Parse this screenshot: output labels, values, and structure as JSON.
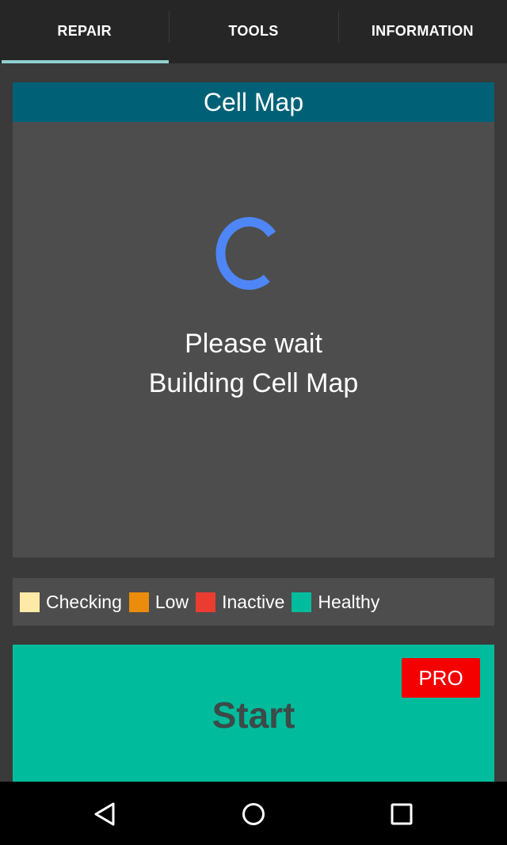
{
  "tabs": [
    {
      "label": "REPAIR",
      "active": true
    },
    {
      "label": "TOOLS",
      "active": false
    },
    {
      "label": "INFORMATION",
      "active": false
    }
  ],
  "cell_map": {
    "title": "Cell Map",
    "status_line1": "Please wait",
    "status_line2": "Building Cell Map",
    "spinner_icon": "loading-spinner-icon"
  },
  "legend": [
    {
      "label": "Checking",
      "color": "#ffe9a6"
    },
    {
      "label": "Low",
      "color": "#ec8c0c"
    },
    {
      "label": "Inactive",
      "color": "#ea3c31"
    },
    {
      "label": "Healthy",
      "color": "#00bc9c"
    }
  ],
  "start_button": {
    "label": "Start",
    "badge": "PRO",
    "color": "#00bc9c",
    "badge_color": "#f40000"
  },
  "colors": {
    "header": "#006176",
    "panel": "#4d4d4d",
    "tab_indicator": "#8fd0d1",
    "spinner": "#4f86f7"
  },
  "navbar": {
    "icons": [
      "back-icon",
      "home-icon",
      "recents-icon"
    ]
  }
}
